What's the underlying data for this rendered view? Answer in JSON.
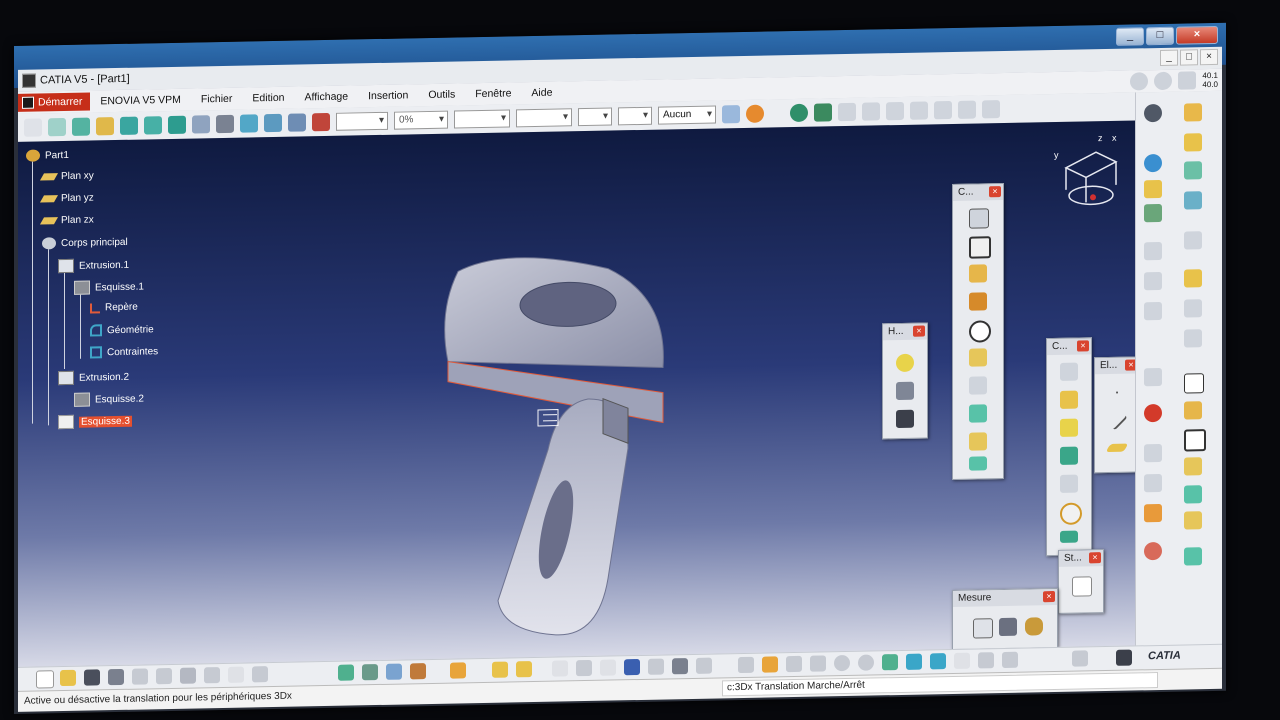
{
  "window": {
    "app_title": "CATIA V5 - [Part1]",
    "app_buttons": [
      "_",
      "□",
      "×"
    ],
    "outer_buttons": [
      "_",
      "□",
      "×"
    ]
  },
  "menu": {
    "start": "Démarrer",
    "items": [
      "ENOVIA V5 VPM",
      "Fichier",
      "Edition",
      "Affichage",
      "Insertion",
      "Outils",
      "Fenêtre",
      "Aide"
    ]
  },
  "toolbar": {
    "percent_combo": "0%",
    "layer_combo": "Aucun",
    "zoom_readout_top": "40.1",
    "zoom_readout_bottom": "40.0"
  },
  "tree": {
    "items": [
      {
        "label": "Part1",
        "icon": "part-icon"
      },
      {
        "label": "Plan xy",
        "icon": "plane-icon"
      },
      {
        "label": "Plan yz",
        "icon": "plane-icon"
      },
      {
        "label": "Plan zx",
        "icon": "plane-icon"
      },
      {
        "label": "Corps principal",
        "icon": "body-icon"
      },
      {
        "label": "Extrusion.1",
        "icon": "pad-icon"
      },
      {
        "label": "Esquisse.1",
        "icon": "sketch-icon"
      },
      {
        "label": "Repère",
        "icon": "axis-icon"
      },
      {
        "label": "Géométrie",
        "icon": "geometry-icon"
      },
      {
        "label": "Contraintes",
        "icon": "constraints-icon"
      },
      {
        "label": "Extrusion.2",
        "icon": "pad-icon"
      },
      {
        "label": "Esquisse.2",
        "icon": "sketch-icon"
      },
      {
        "label": "Esquisse.3",
        "icon": "sketch-icon"
      }
    ]
  },
  "palettes": {
    "p1_title": "C...",
    "p2_title": "H...",
    "p3_title": "C...",
    "p4_title": "El...",
    "p5_title": "St...",
    "p6_title": "Mesure"
  },
  "compass": {
    "x_label": "x",
    "y_label": "y",
    "z_label": "z"
  },
  "statusbar": {
    "message": "Active ou désactive la translation pour les périphériques 3Dx",
    "command": "c:3Dx Translation Marche/Arrêt"
  },
  "branding": {
    "logo_text": "CATIA",
    "accent": "#c62e19",
    "selection": "#e5502f"
  }
}
